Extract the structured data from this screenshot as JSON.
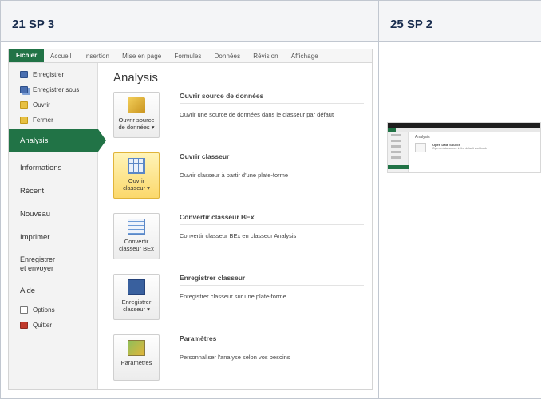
{
  "table": {
    "col1_header": "21 SP 3",
    "col2_header": "25 SP 2"
  },
  "excel": {
    "ribbon_tabs": [
      "Fichier",
      "Accueil",
      "Insertion",
      "Mise en page",
      "Formules",
      "Données",
      "Révision",
      "Affichage"
    ],
    "nav": {
      "save": "Enregistrer",
      "save_as": "Enregistrer sous",
      "open": "Ouvrir",
      "close": "Fermer",
      "analysis": "Analysis",
      "info": "Informations",
      "recent": "Récent",
      "new": "Nouveau",
      "print": "Imprimer",
      "save_send_1": "Enregistrer",
      "save_send_2": "et envoyer",
      "help": "Aide",
      "options": "Options",
      "quit": "Quitter"
    },
    "main_title": "Analysis",
    "entries": [
      {
        "btn1": "Ouvrir source",
        "btn2": "de données ▾",
        "title": "Ouvrir source de données",
        "desc": "Ouvrir une source de données dans le classeur par défaut"
      },
      {
        "btn1": "Ouvrir",
        "btn2": "classeur ▾",
        "title": "Ouvrir classeur",
        "desc": "Ouvrir classeur à partir d'une plate-forme"
      },
      {
        "btn1": "Convertir",
        "btn2": "classeur BEx",
        "title": "Convertir classeur BEx",
        "desc": "Convertir classeur BEx en classeur Analysis"
      },
      {
        "btn1": "Enregistrer",
        "btn2": "classeur ▾",
        "title": "Enregistrer classeur",
        "desc": "Enregistrer classeur sur une plate-forme"
      },
      {
        "btn1": "Paramètres",
        "btn2": "",
        "title": "Paramètres",
        "desc": "Personnaliser l'analyse selon vos besoins"
      }
    ]
  },
  "thumb": {
    "title": "Analysis",
    "entry_title": "Open Data Source",
    "entry_desc": "Open a data source in the default workbook"
  }
}
